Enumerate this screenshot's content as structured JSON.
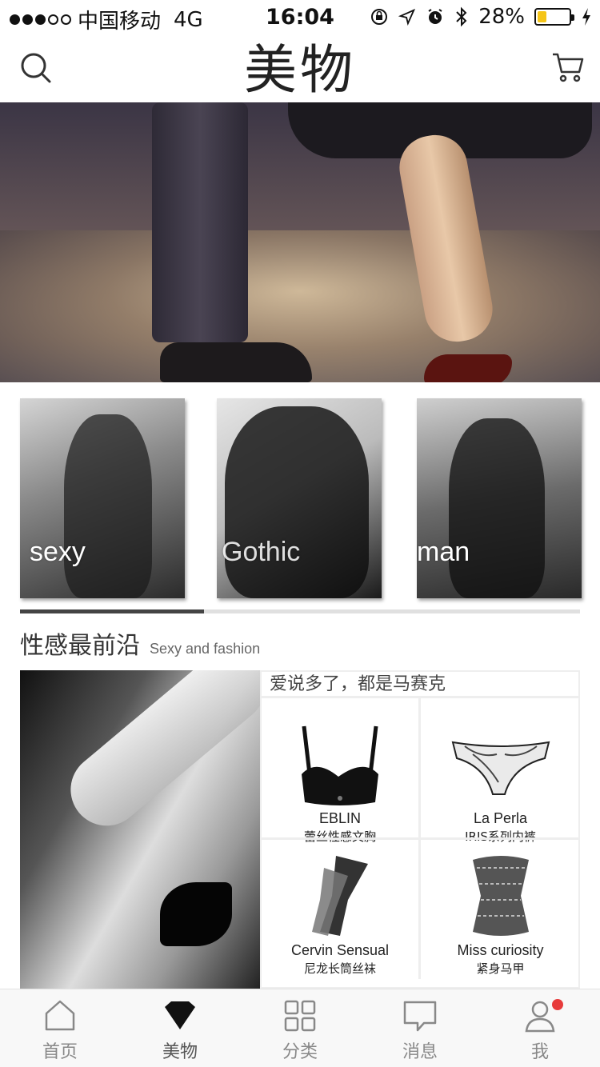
{
  "status_bar": {
    "carrier": "中国移动",
    "network": "4G",
    "time": "16:04",
    "battery_percent": "28%",
    "battery_level": 0.28,
    "icons": [
      "lock-rotation-icon",
      "location-icon",
      "alarm-icon",
      "bluetooth-icon",
      "charging-icon"
    ]
  },
  "nav": {
    "title": "美物",
    "left_icon": "search-icon",
    "right_icon": "cart-icon"
  },
  "categories": [
    {
      "label": "sexy"
    },
    {
      "label": "Gothic"
    },
    {
      "label": "man"
    }
  ],
  "scroll_indicator": {
    "position": 0.33
  },
  "section": {
    "title": "性感最前沿",
    "subtitle": "Sexy and fashion"
  },
  "feature": {
    "caption": "爱说多了，都是马赛克",
    "products": [
      {
        "brand": "EBLIN",
        "name": "蕾丝性感文胸",
        "icon": "bra-icon"
      },
      {
        "brand": "La Perla",
        "name": "IRIS系列内裤",
        "icon": "panties-icon"
      },
      {
        "brand": "Cervin Sensual",
        "name": "尼龙长筒丝袜",
        "icon": "stockings-icon"
      },
      {
        "brand": "Miss curiosity",
        "name": "紧身马甲",
        "icon": "corset-icon"
      }
    ]
  },
  "tab_bar": {
    "tabs": [
      {
        "label": "首页",
        "icon": "home-icon"
      },
      {
        "label": "美物",
        "icon": "diamond-icon",
        "active": true
      },
      {
        "label": "分类",
        "icon": "grid-icon"
      },
      {
        "label": "消息",
        "icon": "message-icon"
      },
      {
        "label": "我",
        "icon": "user-icon",
        "badge": true
      }
    ]
  },
  "colors": {
    "badge": "#e73b3b",
    "battery": "#f5c518",
    "text_primary": "#222222"
  }
}
